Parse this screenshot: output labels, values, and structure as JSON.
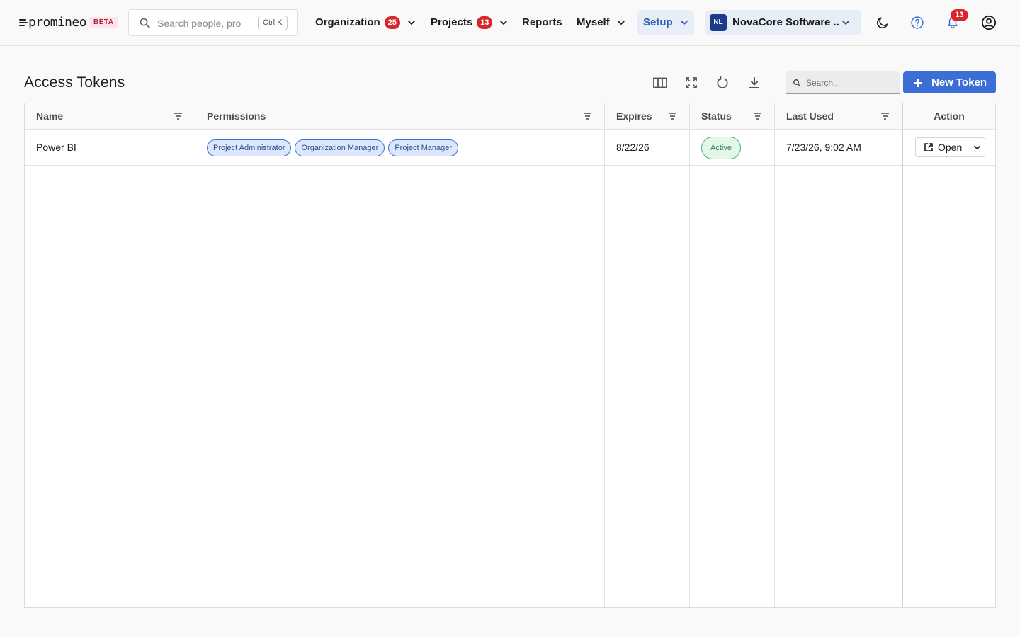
{
  "brand": {
    "name": "promineo",
    "beta": "BETA"
  },
  "global_search": {
    "placeholder": "Search people, projects",
    "shortcut": "Ctrl K"
  },
  "nav": {
    "organization": {
      "label": "Organization",
      "badge": "25"
    },
    "projects": {
      "label": "Projects",
      "badge": "13"
    },
    "reports": {
      "label": "Reports"
    },
    "myself": {
      "label": "Myself"
    },
    "setup": {
      "label": "Setup",
      "active": true
    }
  },
  "org_switcher": {
    "initials": "NL",
    "name": "NovaCore Software ..."
  },
  "notifications": {
    "count": "13"
  },
  "page": {
    "title": "Access Tokens"
  },
  "toolbar": {
    "search_placeholder": "Search...",
    "new_token_label": "New Token"
  },
  "table": {
    "columns": [
      "Name",
      "Permissions",
      "Expires",
      "Status",
      "Last Used",
      "Action"
    ],
    "rows": [
      {
        "name": "Power BI",
        "permissions": [
          "Project Administrator",
          "Organization Manager",
          "Project Manager"
        ],
        "expires": "8/22/26",
        "status": "Active",
        "last_used": "7/23/26, 9:02 AM",
        "action": "Open"
      }
    ]
  },
  "colors": {
    "accent": "#3c6fd6",
    "badge": "#d9262c",
    "active_status": "#4caf74"
  }
}
